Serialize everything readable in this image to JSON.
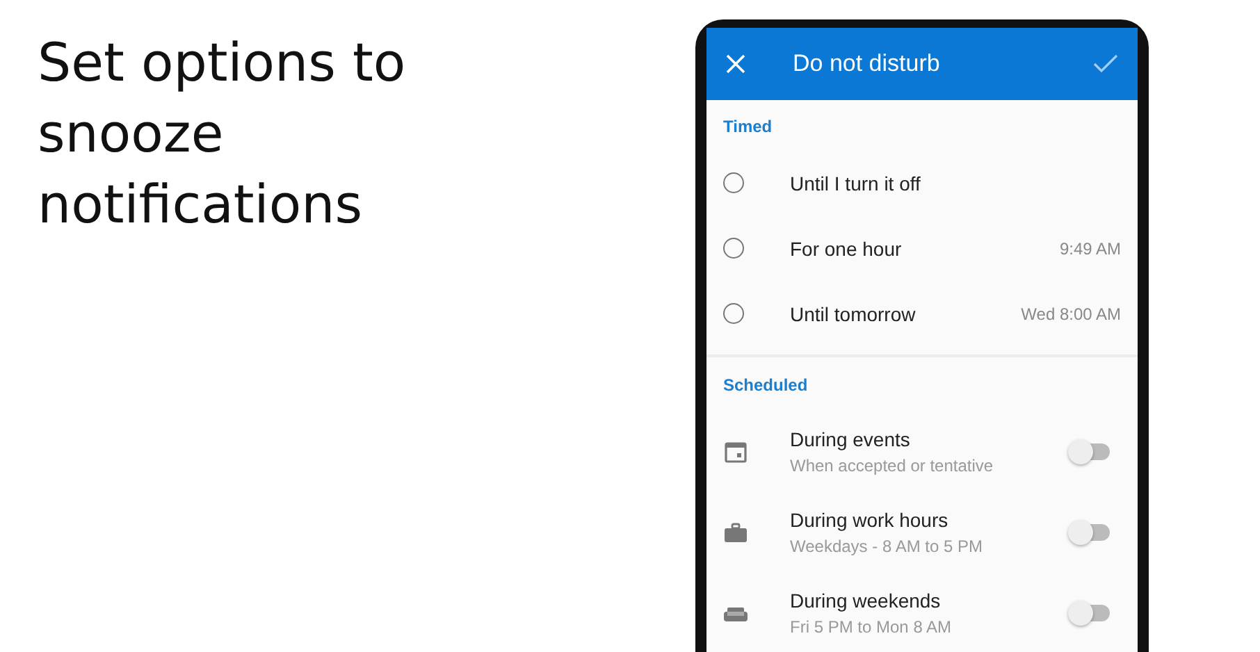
{
  "headline": "Set options to snooze notifications",
  "app_bar": {
    "title": "Do not disturb"
  },
  "sections": [
    {
      "title": "Timed",
      "items": [
        {
          "kind": "radio",
          "label": "Until I turn it off",
          "selected": false
        },
        {
          "kind": "radio",
          "label": "For one hour",
          "time": "9:49 AM",
          "selected": false
        },
        {
          "kind": "radio",
          "label": "Until tomorrow",
          "time": "Wed 8:00 AM",
          "selected": false
        }
      ]
    },
    {
      "title": "Scheduled",
      "items": [
        {
          "kind": "toggle",
          "label": "During events",
          "subtitle": "When accepted or tentative",
          "on": false
        },
        {
          "kind": "toggle",
          "label": "During work hours",
          "subtitle": "Weekdays - 8 AM to 5 PM",
          "on": false
        },
        {
          "kind": "toggle",
          "label": "During weekends",
          "subtitle": "Fri 5 PM to Mon 8 AM",
          "on": false
        }
      ]
    }
  ]
}
